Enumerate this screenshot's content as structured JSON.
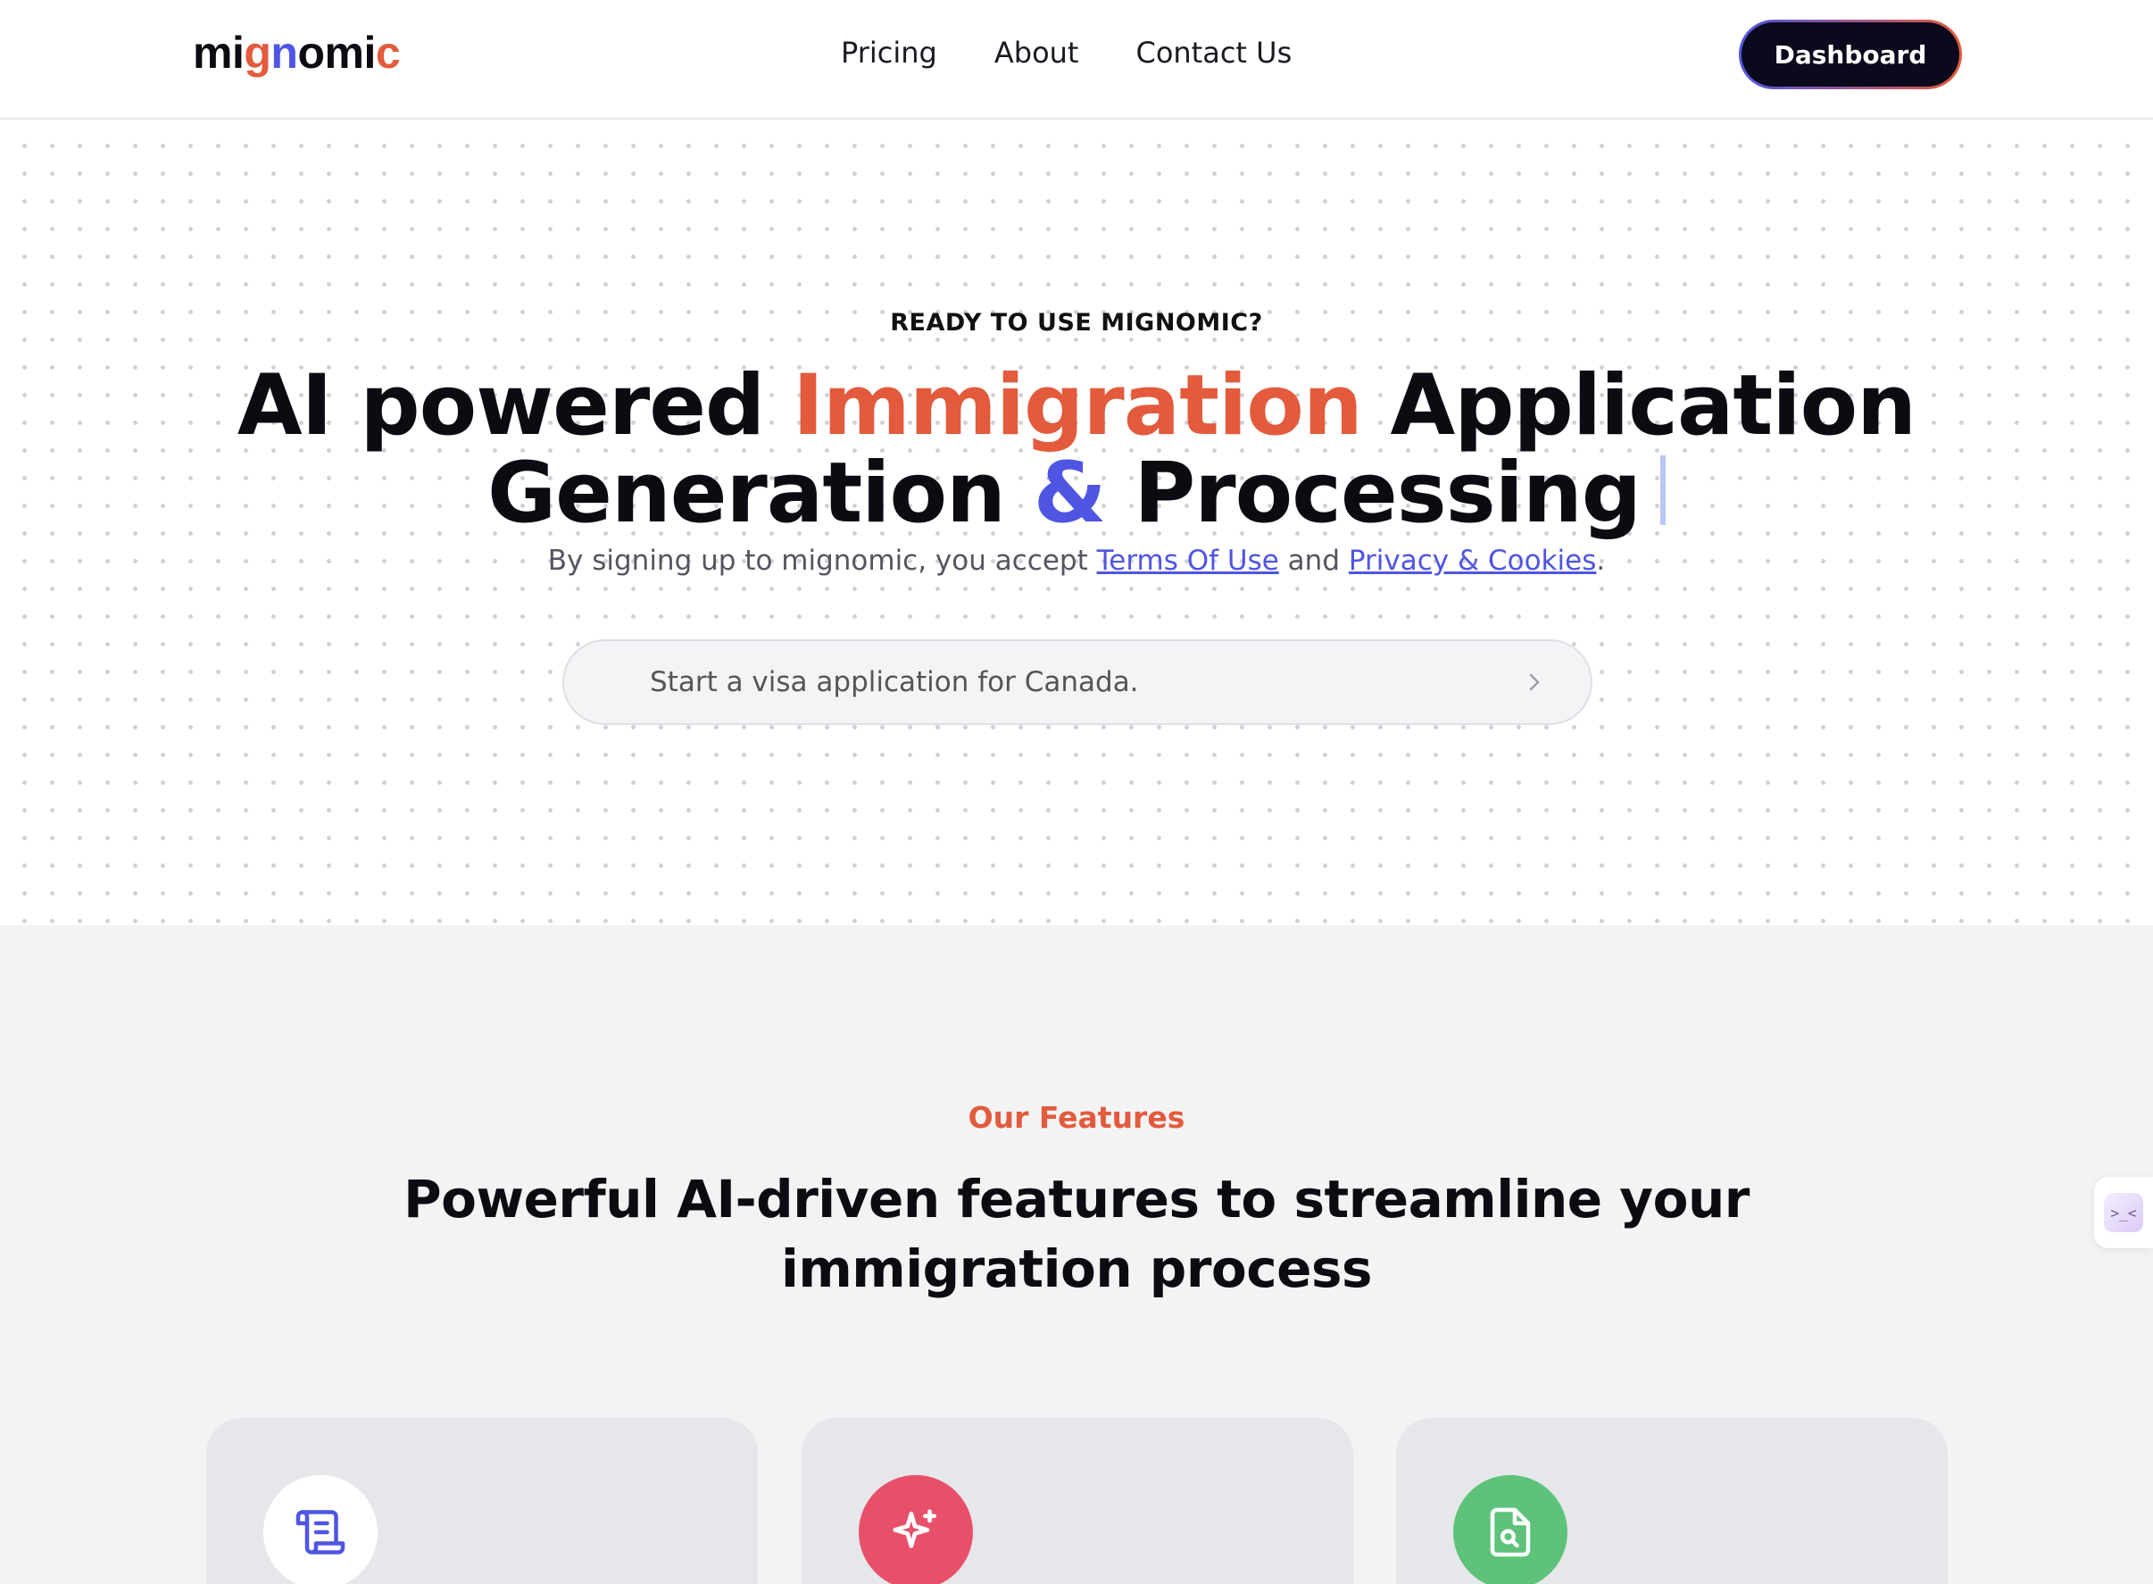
{
  "header": {
    "logo": {
      "part1": "mi",
      "part2": "g",
      "part3": "n",
      "part4": "omi",
      "part5": "c"
    },
    "nav": [
      "Pricing",
      "About",
      "Contact Us"
    ],
    "dashboard_label": "Dashboard"
  },
  "hero": {
    "eyebrow": "READY TO USE MIGNOMIC?",
    "title_part1": "AI powered ",
    "title_accent1": "Immigration",
    "title_part2": " Application",
    "title_part3": "Generation ",
    "title_accent2": "&",
    "title_part4": " Processing",
    "note_prefix": "By signing up to mignomic, you accept ",
    "note_link1": "Terms Of Use",
    "note_mid": " and ",
    "note_link2": "Privacy & Cookies",
    "note_suffix": ".",
    "search_placeholder": "Start a visa application for Canada."
  },
  "features": {
    "eyebrow": "Our Features",
    "title": "Powerful AI-driven features to streamline your immigration process",
    "cards": [
      {
        "icon": "scroll-icon"
      },
      {
        "icon": "sparkle-icon"
      },
      {
        "icon": "file-search-icon"
      }
    ]
  },
  "side_widget": {
    "glyph": ">_<"
  },
  "colors": {
    "accent_red": "#e35a3c",
    "accent_blue": "#4f55e3",
    "dark": "#0a0a1c",
    "green": "#5ec27a",
    "pink": "#e8506a"
  }
}
